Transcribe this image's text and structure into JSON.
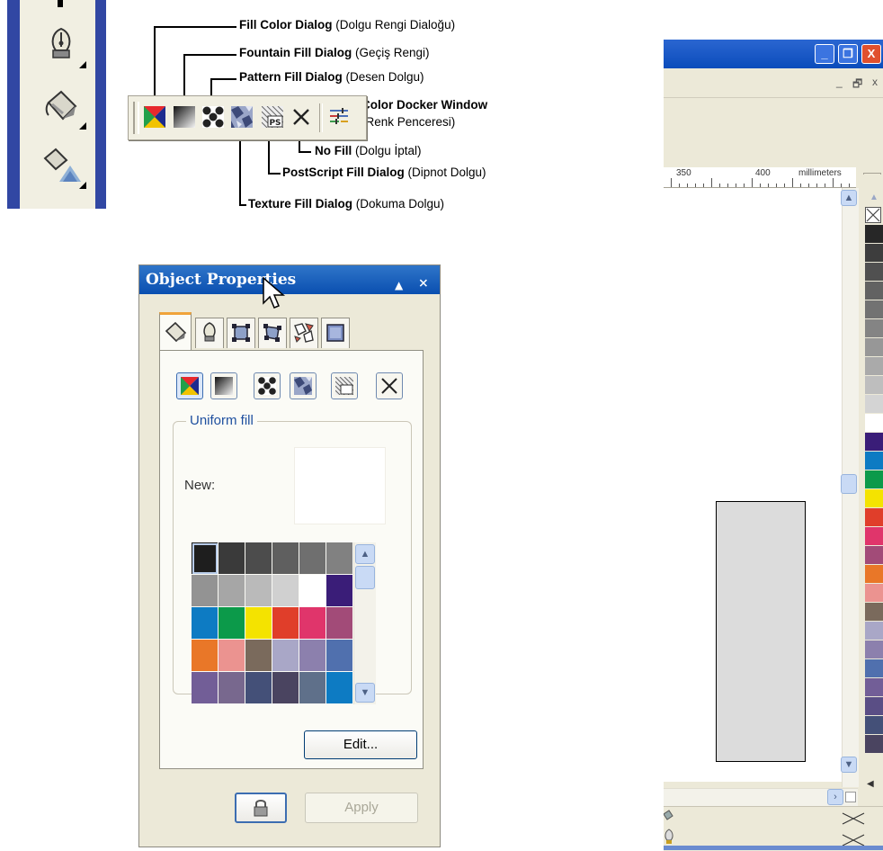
{
  "callouts": {
    "fill_color": {
      "bold": "Fill Color Dialog",
      "rest": " (Dolgu Rengi Dialoğu)"
    },
    "fountain": {
      "bold": "Fountain Fill Dialog",
      "rest": " (Geçiş Rengi)"
    },
    "pattern": {
      "bold": "Pattern Fill Dialog",
      "rest": " (Desen Dolgu)"
    },
    "color_docker": {
      "bold": "Color Docker Window",
      "rest": "(Renk Penceresi)"
    },
    "no_fill": {
      "bold": "No Fill",
      "rest": " (Dolgu İptal)"
    },
    "postscript": {
      "bold": "PostScript Fill Dialog",
      "rest": " (Dipnot Dolgu)"
    },
    "texture": {
      "bold": "Texture Fill Dialog",
      "rest": " (Dokuma Dolgu)"
    }
  },
  "flyout": {
    "buttons": [
      "fill-color",
      "fountain-fill",
      "pattern-fill",
      "texture-fill",
      "postscript-fill",
      "no-fill",
      "color-docker"
    ],
    "ps_label": "PS"
  },
  "docker": {
    "title": "Object Properties",
    "title_buttons": [
      "▲",
      "×"
    ],
    "tabs": [
      "fill-tab",
      "outline-tab",
      "general-tab",
      "detail-tab",
      "internet-tab",
      "summary-tab"
    ],
    "group_label": "Uniform fill",
    "new_label": "New:",
    "edit_label": "Edit...",
    "apply_label": "Apply",
    "scroll_up": "⌃",
    "scroll_down": "⌄",
    "palette_rows": [
      [
        "#1e1e1e",
        "#3a3a3a",
        "#4c4c4c",
        "#5f5f5f",
        "#6f6f6f",
        "#818181"
      ],
      [
        "#939393",
        "#a6a6a6",
        "#bababa",
        "#d0d0d0",
        "#ffffff",
        "#3a1d78"
      ],
      [
        "#0d7bc3",
        "#0c9a4a",
        "#f4e300",
        "#e03e2a",
        "#e0356b",
        "#a24b78"
      ],
      [
        "#e97728",
        "#eb9390",
        "#7a6a5c",
        "#a9a7c7",
        "#8c80ad",
        "#5070ae"
      ],
      [
        "#725e97",
        "#78688e",
        "#445078",
        "#4a4460",
        "#5f708a",
        "#0d7bc3"
      ]
    ]
  },
  "window": {
    "caption_buttons": [
      "_",
      "❐",
      "X"
    ],
    "mdi_buttons": [
      "_",
      "🗗",
      "x"
    ],
    "ruler": {
      "label_350": "350",
      "label_400": "400",
      "unit": "millimeters"
    },
    "palette_column": [
      "#272727",
      "#3d3d3d",
      "#505050",
      "#626262",
      "#727272",
      "#848484",
      "#979797",
      "#aaaaaa",
      "#bebebe",
      "#d4d4d4",
      "#ffffff",
      "#3a1d78",
      "#0d7bc3",
      "#0c9a4a",
      "#f4e300",
      "#e03e2a",
      "#e0356b",
      "#a24b78",
      "#e97728",
      "#eb9390",
      "#7a6a5c",
      "#a9a7c7",
      "#8c80ad",
      "#5070ae",
      "#725e97",
      "#5a4e85",
      "#445078",
      "#4a4460"
    ],
    "scroll_right": "›",
    "first_page": "◀"
  }
}
